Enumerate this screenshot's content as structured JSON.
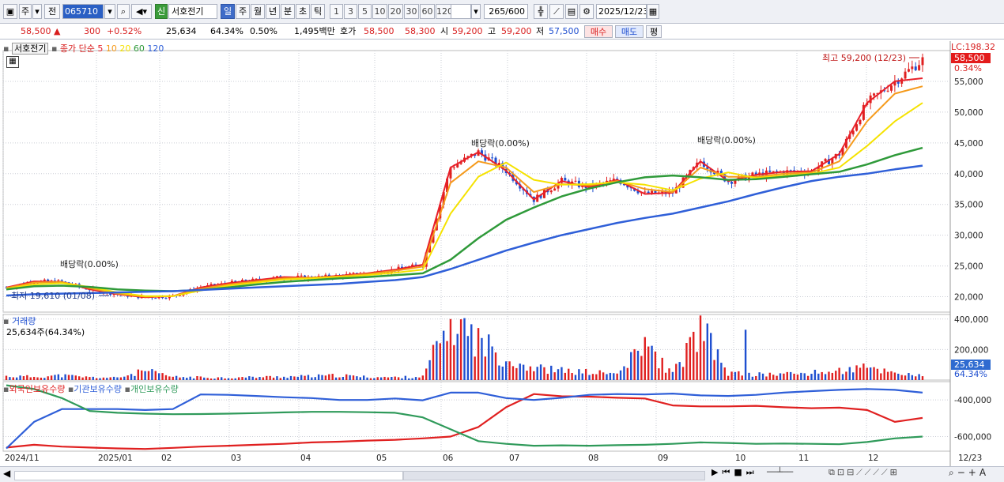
{
  "toolbar": {
    "period_primary": "주",
    "period_secondary": "전",
    "stock_code": "065710",
    "stock_badge": "신",
    "stock_name": "서호전기",
    "periods": [
      "일",
      "주",
      "월",
      "년",
      "분",
      "초",
      "틱"
    ],
    "selected_period": "일",
    "intervals": [
      "1",
      "3",
      "5",
      "10",
      "20",
      "30",
      "60",
      "120"
    ],
    "bar_count": "265",
    "bar_total": "/600",
    "date": "2025/12/23"
  },
  "info": {
    "price": "58,500",
    "change": "300",
    "change_pct": "+0.52%",
    "volume": "25,634",
    "volume_ratio": "64.34%",
    "turnover_pct": "0.50%",
    "amount": "1,495백만",
    "quote_label": "호가",
    "ask": "58,500",
    "bid": "58,300",
    "open_label": "시",
    "open": "59,200",
    "high_label": "고",
    "high": "59,200",
    "low_label": "저",
    "low": "57,500",
    "buy_button": "매수",
    "sell_button": "매도",
    "eval_button": "평"
  },
  "legend": {
    "name": "서호전기",
    "series_title": "종가 단순",
    "ma": [
      {
        "label": "5",
        "color": "#e8202a"
      },
      {
        "label": "10",
        "color": "#f59a1b"
      },
      {
        "label": "20",
        "color": "#f5e200"
      },
      {
        "label": "60",
        "color": "#2f9a3a"
      },
      {
        "label": "120",
        "color": "#2f5fd8"
      }
    ],
    "lc_label": "LC:198.32",
    "last_price_tag": "58,500",
    "last_pct_tag": "0.34%",
    "volume_title": "거래량",
    "volume_value": "25,634주(64.34%)",
    "volume_tag": "25,634",
    "volume_pct_tag": "64.34%",
    "holding_series": [
      {
        "label": "외국인보유수량",
        "color": "#e02020"
      },
      {
        "label": "기관보유수량",
        "color": "#2f5fd8"
      },
      {
        "label": "개인보유수량",
        "color": "#2f9a5a"
      }
    ]
  },
  "annotations": {
    "high": "최고 59,200 (12/23)",
    "low": "최저 19,610 (01/08)",
    "dividend": "배당락(0.00%)"
  },
  "chart_data": {
    "type": "line",
    "panels": [
      {
        "name": "price",
        "ylim": [
          17500,
          60000
        ],
        "yticks": [
          20000,
          25000,
          30000,
          35000,
          40000,
          45000,
          50000,
          55000
        ],
        "ytick_labels": [
          "20,000",
          "25,000",
          "30,000",
          "35,000",
          "40,000",
          "45,000",
          "50,000",
          "55,000"
        ],
        "x": [
          "2024/11",
          "2025/01",
          "02",
          "03",
          "04",
          "05",
          "06",
          "07",
          "08",
          "09",
          "10",
          "11",
          "12"
        ],
        "series": [
          {
            "name": "종가",
            "style": "candlestick",
            "values": [
              21500,
              22500,
              22400,
              21200,
              20400,
              19900,
              20100,
              21500,
              22200,
              22700,
              23200,
              23100,
              23400,
              23800,
              24400,
              25200,
              41000,
              43500,
              40500,
              35800,
              38800,
              37800,
              39000,
              36700,
              36900,
              42000,
              38800,
              39800,
              40300,
              40400,
              43200,
              51500,
              55000,
              58500
            ]
          },
          {
            "name": "5",
            "values": [
              21500,
              22500,
              22400,
              21200,
              20400,
              19900,
              20100,
              21500,
              22200,
              22700,
              23200,
              23100,
              23400,
              23800,
              24400,
              25200,
              41000,
              43500,
              40500,
              35800,
              38800,
              37800,
              39000,
              36700,
              36900,
              42000,
              38800,
              39800,
              40300,
              40400,
              43200,
              51500,
              55000,
              55500
            ]
          },
          {
            "name": "10",
            "values": [
              21400,
              22300,
              22400,
              21400,
              20500,
              20000,
              20100,
              21300,
              22000,
              22500,
              23000,
              23100,
              23300,
              23700,
              24200,
              24900,
              38500,
              42000,
              41000,
              37000,
              38300,
              38100,
              38800,
              37500,
              37000,
              41000,
              39500,
              39500,
              40000,
              40200,
              42000,
              48500,
              53000,
              54200
            ]
          },
          {
            "name": "20",
            "values": [
              21300,
              22000,
              22200,
              21600,
              20700,
              20100,
              20100,
              21000,
              21800,
              22300,
              22800,
              23000,
              23200,
              23500,
              23900,
              24400,
              33500,
              39500,
              41800,
              39000,
              38200,
              38300,
              38600,
              38200,
              37300,
              39200,
              40200,
              39300,
              39700,
              40000,
              41000,
              44500,
              48500,
              51500
            ]
          },
          {
            "name": "60",
            "values": [
              21200,
              21700,
              21800,
              21600,
              21200,
              21000,
              20900,
              21100,
              21500,
              22000,
              22400,
              22700,
              23000,
              23200,
              23500,
              23800,
              26000,
              29500,
              32500,
              34500,
              36300,
              37600,
              38600,
              39400,
              39700,
              39400,
              39000,
              39100,
              39500,
              39900,
              40300,
              41500,
              43000,
              44200
            ]
          },
          {
            "name": "120",
            "values": [
              20200,
              20400,
              20500,
              20600,
              20700,
              20800,
              20900,
              21100,
              21300,
              21500,
              21700,
              21900,
              22100,
              22400,
              22700,
              23200,
              24500,
              26000,
              27500,
              28800,
              30000,
              31000,
              32000,
              32800,
              33500,
              34500,
              35500,
              36700,
              37800,
              38800,
              39500,
              40000,
              40700,
              41300
            ]
          }
        ]
      },
      {
        "name": "volume",
        "ylim": [
          0,
          430000
        ],
        "yticks": [
          200000,
          400000
        ],
        "ytick_labels": [
          "200,000",
          "400,000"
        ],
        "values": [
          25000,
          22000,
          30000,
          18000,
          15000,
          60000,
          20000,
          18000,
          15000,
          20000,
          22000,
          25000,
          30000,
          20000,
          18000,
          22000,
          400000,
          260000,
          140000,
          80000,
          60000,
          50000,
          40000,
          220000,
          40000,
          330000,
          45000,
          35000,
          40000,
          45000,
          60000,
          80000,
          50000,
          25634
        ]
      },
      {
        "name": "holdings",
        "ylim": [
          -680000,
          -300000
        ],
        "yticks": [
          -400000,
          -600000
        ],
        "ytick_labels": [
          "-400,000",
          "-600,000"
        ],
        "series": [
          {
            "name": "외국인보유수량",
            "values": [
              -660000,
              -645000,
              -655000,
              -660000,
              -665000,
              -668000,
              -662000,
              -655000,
              -650000,
              -645000,
              -640000,
              -632000,
              -628000,
              -622000,
              -618000,
              -610000,
              -600000,
              -548000,
              -440000,
              -368000,
              -380000,
              -382000,
              -388000,
              -392000,
              -430000,
              -435000,
              -435000,
              -432000,
              -440000,
              -445000,
              -442000,
              -455000,
              -520000,
              -498000
            ]
          },
          {
            "name": "기관보유수량",
            "values": [
              -665000,
              -520000,
              -450000,
              -450000,
              -450000,
              -455000,
              -450000,
              -370000,
              -372000,
              -378000,
              -385000,
              -390000,
              -400000,
              -400000,
              -392000,
              -402000,
              -360000,
              -360000,
              -390000,
              -400000,
              -388000,
              -372000,
              -368000,
              -370000,
              -365000,
              -375000,
              -378000,
              -372000,
              -360000,
              -352000,
              -345000,
              -340000,
              -345000,
              -360000
            ]
          },
          {
            "name": "개인보유수량",
            "values": [
              -320000,
              -340000,
              -390000,
              -460000,
              -470000,
              -475000,
              -478000,
              -477000,
              -475000,
              -472000,
              -468000,
              -465000,
              -465000,
              -467000,
              -470000,
              -495000,
              -560000,
              -625000,
              -640000,
              -650000,
              -648000,
              -650000,
              -647000,
              -645000,
              -640000,
              -632000,
              -635000,
              -640000,
              -638000,
              -640000,
              -642000,
              -630000,
              -610000,
              -600000
            ]
          }
        ]
      }
    ],
    "xlabel": "",
    "ylabel": ""
  },
  "bottom_date": "12/23"
}
